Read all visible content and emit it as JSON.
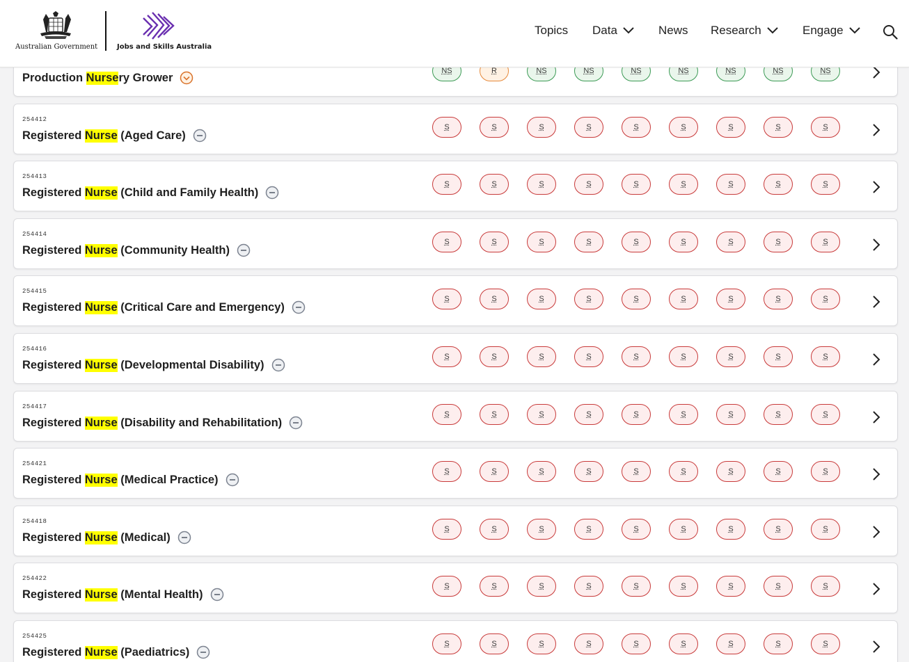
{
  "header": {
    "gov_logo_text": "Australian Government",
    "jsa_logo_text": "Jobs and Skills Australia",
    "nav": [
      {
        "label": "Topics",
        "has_dropdown": false
      },
      {
        "label": "Data",
        "has_dropdown": true
      },
      {
        "label": "News",
        "has_dropdown": false
      },
      {
        "label": "Research",
        "has_dropdown": true
      },
      {
        "label": "Engage",
        "has_dropdown": true
      }
    ],
    "search_icon": "search-icon"
  },
  "colors": {
    "shortage_border": "#c83a3a",
    "no_shortage_border": "#3c9a55",
    "regional_border": "#e6893a",
    "highlight": "#ffff00",
    "jsa_purple": "#6a2fb0"
  },
  "occupations": [
    {
      "code": "",
      "pre": "Production ",
      "match": "Nurse",
      "post": "ry Grower",
      "status_icon": "chevron-circle-down-icon",
      "ratings": [
        "NS",
        "R",
        "NS",
        "NS",
        "NS",
        "NS",
        "NS",
        "NS",
        "NS"
      ]
    },
    {
      "code": "254412",
      "pre": "Registered ",
      "match": "Nurse",
      "post": " (Aged Care)",
      "status_icon": "minus-circle-icon",
      "ratings": [
        "S",
        "S",
        "S",
        "S",
        "S",
        "S",
        "S",
        "S",
        "S"
      ]
    },
    {
      "code": "254413",
      "pre": "Registered ",
      "match": "Nurse",
      "post": " (Child and Family Health)",
      "status_icon": "minus-circle-icon",
      "ratings": [
        "S",
        "S",
        "S",
        "S",
        "S",
        "S",
        "S",
        "S",
        "S"
      ]
    },
    {
      "code": "254414",
      "pre": "Registered ",
      "match": "Nurse",
      "post": " (Community Health)",
      "status_icon": "minus-circle-icon",
      "ratings": [
        "S",
        "S",
        "S",
        "S",
        "S",
        "S",
        "S",
        "S",
        "S"
      ]
    },
    {
      "code": "254415",
      "pre": "Registered ",
      "match": "Nurse",
      "post": " (Critical Care and Emergency)",
      "status_icon": "minus-circle-icon",
      "ratings": [
        "S",
        "S",
        "S",
        "S",
        "S",
        "S",
        "S",
        "S",
        "S"
      ]
    },
    {
      "code": "254416",
      "pre": "Registered ",
      "match": "Nurse",
      "post": " (Developmental Disability)",
      "status_icon": "minus-circle-icon",
      "ratings": [
        "S",
        "S",
        "S",
        "S",
        "S",
        "S",
        "S",
        "S",
        "S"
      ]
    },
    {
      "code": "254417",
      "pre": "Registered ",
      "match": "Nurse",
      "post": " (Disability and Rehabilitation)",
      "status_icon": "minus-circle-icon",
      "ratings": [
        "S",
        "S",
        "S",
        "S",
        "S",
        "S",
        "S",
        "S",
        "S"
      ]
    },
    {
      "code": "254421",
      "pre": "Registered ",
      "match": "Nurse",
      "post": " (Medical Practice)",
      "status_icon": "minus-circle-icon",
      "ratings": [
        "S",
        "S",
        "S",
        "S",
        "S",
        "S",
        "S",
        "S",
        "S"
      ]
    },
    {
      "code": "254418",
      "pre": "Registered ",
      "match": "Nurse",
      "post": " (Medical)",
      "status_icon": "minus-circle-icon",
      "ratings": [
        "S",
        "S",
        "S",
        "S",
        "S",
        "S",
        "S",
        "S",
        "S"
      ]
    },
    {
      "code": "254422",
      "pre": "Registered ",
      "match": "Nurse",
      "post": " (Mental Health)",
      "status_icon": "minus-circle-icon",
      "ratings": [
        "S",
        "S",
        "S",
        "S",
        "S",
        "S",
        "S",
        "S",
        "S"
      ]
    },
    {
      "code": "254425",
      "pre": "Registered ",
      "match": "Nurse",
      "post": " (Paediatrics)",
      "status_icon": "minus-circle-icon",
      "ratings": [
        "S",
        "S",
        "S",
        "S",
        "S",
        "S",
        "S",
        "S",
        "S"
      ]
    }
  ]
}
